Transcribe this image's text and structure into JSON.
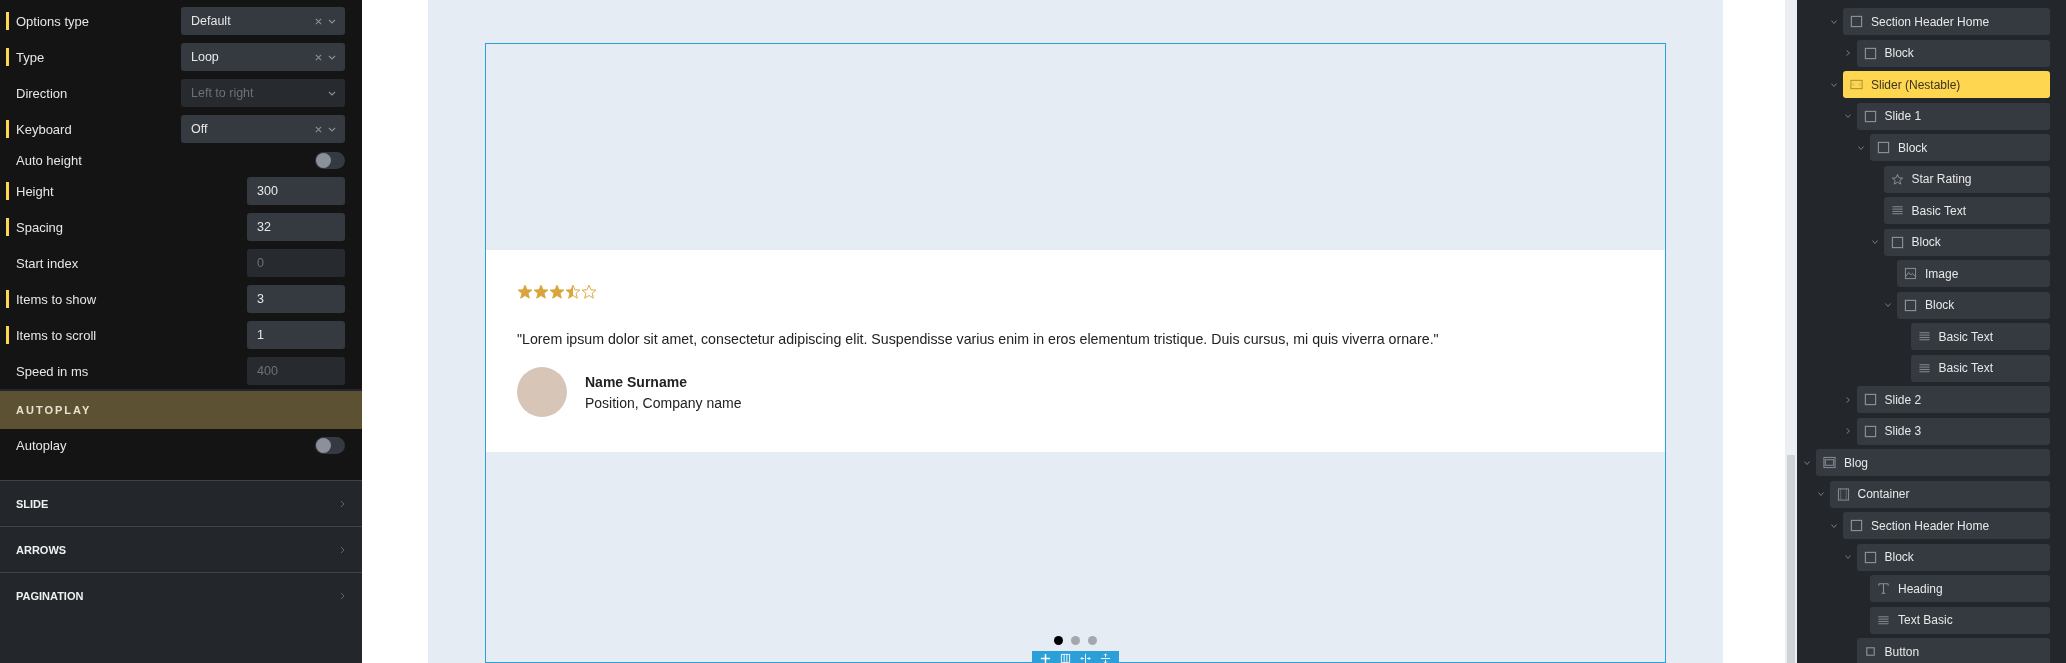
{
  "settings": {
    "fields": [
      {
        "kind": "select",
        "label": "Options type",
        "modified": true,
        "value": "Default",
        "clearable": true,
        "disabled": false
      },
      {
        "kind": "select",
        "label": "Type",
        "modified": true,
        "value": "Loop",
        "clearable": true,
        "disabled": false
      },
      {
        "kind": "select",
        "label": "Direction",
        "modified": false,
        "placeholder": "Left to right",
        "clearable": false,
        "disabled": true
      },
      {
        "kind": "select",
        "label": "Keyboard",
        "modified": true,
        "value": "Off",
        "clearable": true,
        "disabled": false
      },
      {
        "kind": "toggle",
        "label": "Auto height",
        "modified": false,
        "on": false
      },
      {
        "kind": "number",
        "label": "Height",
        "modified": true,
        "value": "300",
        "disabled": false
      },
      {
        "kind": "number",
        "label": "Spacing",
        "modified": true,
        "value": "32",
        "disabled": false
      },
      {
        "kind": "number",
        "label": "Start index",
        "modified": false,
        "placeholder": "0",
        "disabled": true
      },
      {
        "kind": "number",
        "label": "Items to show",
        "modified": true,
        "value": "3",
        "disabled": false
      },
      {
        "kind": "number",
        "label": "Items to scroll",
        "modified": true,
        "value": "1",
        "disabled": false
      },
      {
        "kind": "number",
        "label": "Speed in ms",
        "modified": false,
        "placeholder": "400",
        "disabled": true
      }
    ],
    "autoplay": {
      "title": "AUTOPLAY",
      "fields": [
        {
          "kind": "toggle",
          "label": "Autoplay",
          "modified": false,
          "on": false
        }
      ]
    },
    "sections": [
      "SLIDE",
      "ARROWS",
      "PAGINATION"
    ]
  },
  "canvas": {
    "testimonial": {
      "stars": 3.5,
      "quote": "\"Lorem ipsum dolor sit amet, consectetur adipiscing elit. Suspendisse varius enim in eros elementum tristique. Duis cursus, mi quis viverra ornare.\"",
      "name": "Name Surname",
      "position": "Position, Company name"
    },
    "pagination": [
      {
        "selected": true
      },
      {
        "selected": false
      },
      {
        "selected": false
      }
    ]
  },
  "tree": {
    "continued": [
      {
        "label": "Section Header Home",
        "kind": "block",
        "selected": false,
        "expanded": true,
        "children": [
          {
            "label": "Block",
            "kind": "block",
            "selected": false,
            "expanded": false
          }
        ]
      },
      {
        "label": "Slider (Nestable)",
        "kind": "slider",
        "selected": true,
        "expanded": true,
        "children": [
          {
            "label": "Slide 1",
            "kind": "block",
            "selected": false,
            "expanded": true,
            "children": [
              {
                "label": "Block",
                "kind": "block",
                "selected": false,
                "expanded": true,
                "children": [
                  {
                    "label": "Star Rating",
                    "kind": "star",
                    "selected": false
                  },
                  {
                    "label": "Basic Text",
                    "kind": "text",
                    "selected": false
                  },
                  {
                    "label": "Block",
                    "kind": "block",
                    "selected": false,
                    "expanded": true,
                    "children": [
                      {
                        "label": "Image",
                        "kind": "image",
                        "selected": false
                      },
                      {
                        "label": "Block",
                        "kind": "block",
                        "selected": false,
                        "expanded": true,
                        "children": [
                          {
                            "label": "Basic Text",
                            "kind": "text",
                            "selected": false
                          },
                          {
                            "label": "Basic Text",
                            "kind": "text",
                            "selected": false
                          }
                        ]
                      }
                    ]
                  }
                ]
              }
            ]
          },
          {
            "label": "Slide 2",
            "kind": "block",
            "selected": false,
            "expanded": false
          },
          {
            "label": "Slide 3",
            "kind": "block",
            "selected": false,
            "expanded": false
          }
        ]
      }
    ],
    "items": [
      {
        "label": "Blog",
        "kind": "section",
        "selected": false,
        "expanded": true,
        "children": [
          {
            "label": "Container",
            "kind": "container",
            "selected": false,
            "expanded": true,
            "children": [
              {
                "label": "Section Header Home",
                "kind": "block",
                "selected": false,
                "expanded": true,
                "children": [
                  {
                    "label": "Block",
                    "kind": "block",
                    "selected": false,
                    "expanded": true,
                    "children": [
                      {
                        "label": "Heading",
                        "kind": "heading",
                        "selected": false
                      },
                      {
                        "label": "Text Basic",
                        "kind": "text",
                        "selected": false
                      }
                    ]
                  },
                  {
                    "label": "Button",
                    "kind": "button",
                    "selected": false
                  }
                ]
              }
            ]
          }
        ]
      }
    ]
  }
}
